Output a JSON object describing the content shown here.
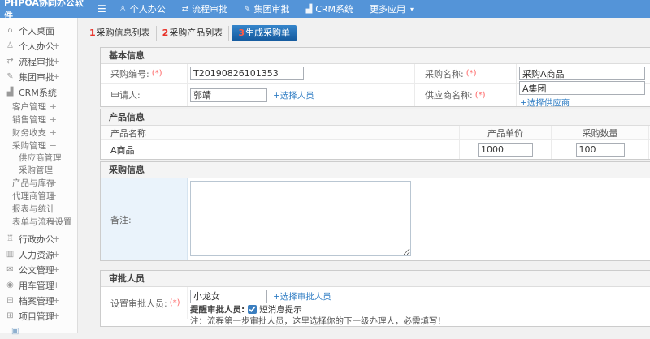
{
  "colors": {
    "topbar_blue": "#5494d8",
    "active_tab_blue": "#13589c",
    "tab_number_red": "#e8332a",
    "link_blue": "#2e7cc3",
    "value_green": "#2f9e1e",
    "required_red": "#ff6666"
  },
  "topbar": {
    "logo": "PHPOA协同办公软件",
    "hamburger_icon": "☰",
    "caret_icon": "▾",
    "menu": {
      "personal": {
        "label": "个人办公",
        "icon": "♙"
      },
      "flow": {
        "label": "流程审批",
        "icon": "⇄"
      },
      "group": {
        "label": "集团审批",
        "icon": "✎"
      },
      "crm": {
        "label": "CRM系统",
        "icon": "▟"
      },
      "more": {
        "label": "更多应用"
      }
    }
  },
  "sidebar": {
    "items": [
      {
        "label": "个人桌面",
        "icon": "⌂"
      },
      {
        "label": "个人办公",
        "icon": "♙",
        "toggle": "+"
      },
      {
        "label": "流程审批",
        "icon": "⇄",
        "toggle": "+"
      },
      {
        "label": "集团审批",
        "icon": "✎",
        "toggle": "+"
      },
      {
        "label": "CRM系统",
        "icon": "▟",
        "toggle": "−"
      },
      {
        "label": "客户管理",
        "toggle": "+"
      },
      {
        "label": "销售管理",
        "toggle": "+"
      },
      {
        "label": "财务收支",
        "toggle": "+"
      },
      {
        "label": "采购管理",
        "toggle": "−"
      },
      {
        "label": "供应商管理"
      },
      {
        "label": "采购管理"
      },
      {
        "label": "产品与库存",
        "toggle": "+"
      },
      {
        "label": "代理商管理",
        "toggle": "+"
      },
      {
        "label": "报表与统计"
      },
      {
        "label": "表单与流程设置",
        "toggle": "+"
      },
      {
        "label": "行政办公",
        "icon": "♖",
        "toggle": "+"
      },
      {
        "label": "人力资源",
        "icon": "▥",
        "toggle": "+"
      },
      {
        "label": "公文管理",
        "icon": "✉",
        "toggle": "+"
      },
      {
        "label": "用车管理",
        "icon": "◉",
        "toggle": "+"
      },
      {
        "label": "档案管理",
        "icon": "⊟",
        "toggle": "+"
      },
      {
        "label": "项目管理",
        "icon": "⊞",
        "toggle": "+"
      }
    ],
    "partial_icon": "▣"
  },
  "tabs": [
    {
      "num": "1",
      "label": "采购信息列表"
    },
    {
      "num": "2",
      "label": "采购产品列表"
    },
    {
      "num": "3",
      "label": "生成采购单"
    }
  ],
  "form": {
    "required": "(*)",
    "basic": {
      "title": "基本信息",
      "purchase_no_label": "采购编号:",
      "purchase_no_value": "T20190826101353",
      "purchase_name_label": "采购名称:",
      "purchase_name_value": "采购A商品",
      "applicant_label": "申请人:",
      "applicant_value": "郭靖",
      "select_person_link": "+选择人员",
      "supplier_label": "供应商名称:",
      "supplier_value": "A集团",
      "select_supplier_link": "+选择供应商"
    },
    "product": {
      "title": "产品信息",
      "col_name": "产品名称",
      "col_price": "产品单价",
      "col_qty": "采购数量",
      "rows": [
        {
          "name": "A商品",
          "price": "1000",
          "qty": "100"
        }
      ]
    },
    "purchase_info": {
      "title": "采购信息",
      "remark_label": "备注:",
      "remark_value": ""
    },
    "approval": {
      "title": "审批人员",
      "set_approver_label": "设置审批人员:",
      "approver_value": "小龙女",
      "select_approver_link": "+选择审批人员",
      "remind_label": "提醒审批人员:",
      "sms_label": "短消息提示",
      "sms_checked": "checked",
      "note": "注：流程第一步审批人员，这里选择你的下一级办理人，必需填写！"
    }
  }
}
